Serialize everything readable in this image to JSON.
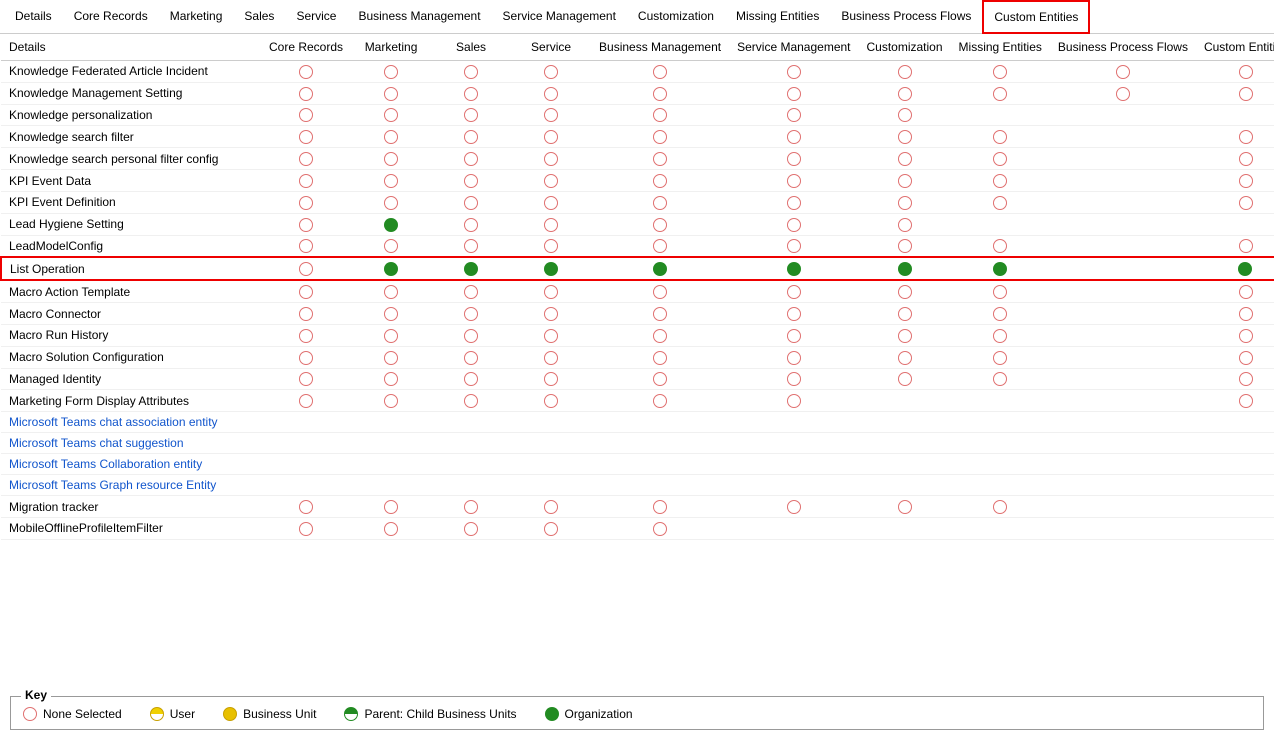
{
  "tabs": [
    {
      "id": "details",
      "label": "Details",
      "active": false,
      "highlighted": false
    },
    {
      "id": "core-records",
      "label": "Core Records",
      "active": false,
      "highlighted": false
    },
    {
      "id": "marketing",
      "label": "Marketing",
      "active": false,
      "highlighted": false
    },
    {
      "id": "sales",
      "label": "Sales",
      "active": false,
      "highlighted": false
    },
    {
      "id": "service",
      "label": "Service",
      "active": false,
      "highlighted": false
    },
    {
      "id": "business-management",
      "label": "Business Management",
      "active": false,
      "highlighted": false
    },
    {
      "id": "service-management",
      "label": "Service Management",
      "active": false,
      "highlighted": false
    },
    {
      "id": "customization",
      "label": "Customization",
      "active": false,
      "highlighted": false
    },
    {
      "id": "missing-entities",
      "label": "Missing Entities",
      "active": false,
      "highlighted": false
    },
    {
      "id": "business-process-flows",
      "label": "Business Process Flows",
      "active": false,
      "highlighted": false
    },
    {
      "id": "custom-entities",
      "label": "Custom Entities",
      "active": false,
      "highlighted": true
    }
  ],
  "columns": [
    "Details",
    "Core Records",
    "Marketing",
    "Sales",
    "Service",
    "Business Management",
    "Service Management",
    "Customization",
    "Missing Entities",
    "Business Process Flows",
    "Custom Entities"
  ],
  "rows": [
    {
      "name": "Knowledge Federated Article Incident",
      "link": false,
      "highlighted": false,
      "circles": [
        "empty",
        "empty",
        "empty",
        "empty",
        "empty",
        "empty",
        "empty",
        "empty",
        "empty",
        "empty",
        "empty"
      ]
    },
    {
      "name": "Knowledge Management Setting",
      "link": false,
      "highlighted": false,
      "circles": [
        "empty",
        "empty",
        "empty",
        "empty",
        "empty",
        "empty",
        "empty",
        "empty",
        "empty",
        "empty",
        "empty"
      ]
    },
    {
      "name": "Knowledge personalization",
      "link": false,
      "highlighted": false,
      "circles": [
        "empty",
        "empty",
        "empty",
        "empty",
        "empty",
        "empty",
        "empty",
        "empty",
        "none",
        "none",
        "none"
      ]
    },
    {
      "name": "Knowledge search filter",
      "link": false,
      "highlighted": false,
      "circles": [
        "empty",
        "empty",
        "empty",
        "empty",
        "empty",
        "empty",
        "empty",
        "empty",
        "empty",
        "none",
        "empty"
      ]
    },
    {
      "name": "Knowledge search personal filter config",
      "link": false,
      "highlighted": false,
      "circles": [
        "empty",
        "empty",
        "empty",
        "empty",
        "empty",
        "empty",
        "empty",
        "empty",
        "empty",
        "none",
        "empty"
      ]
    },
    {
      "name": "KPI Event Data",
      "link": false,
      "highlighted": false,
      "circles": [
        "empty",
        "empty",
        "empty",
        "empty",
        "empty",
        "empty",
        "empty",
        "empty",
        "empty",
        "none",
        "empty"
      ]
    },
    {
      "name": "KPI Event Definition",
      "link": false,
      "highlighted": false,
      "circles": [
        "empty",
        "empty",
        "empty",
        "empty",
        "empty",
        "empty",
        "empty",
        "empty",
        "empty",
        "none",
        "empty"
      ]
    },
    {
      "name": "Lead Hygiene Setting",
      "link": false,
      "highlighted": false,
      "circles": [
        "empty",
        "empty",
        "green",
        "empty",
        "empty",
        "empty",
        "empty",
        "empty",
        "none",
        "none",
        "none"
      ]
    },
    {
      "name": "LeadModelConfig",
      "link": false,
      "highlighted": false,
      "circles": [
        "empty",
        "empty",
        "empty",
        "empty",
        "empty",
        "empty",
        "empty",
        "empty",
        "empty",
        "none",
        "empty"
      ]
    },
    {
      "name": "List Operation",
      "link": false,
      "highlighted": true,
      "circles": [
        "empty",
        "empty",
        "green",
        "green",
        "green",
        "green",
        "green",
        "green",
        "green",
        "none",
        "green"
      ]
    },
    {
      "name": "Macro Action Template",
      "link": false,
      "highlighted": false,
      "circles": [
        "empty",
        "empty",
        "empty",
        "empty",
        "empty",
        "empty",
        "empty",
        "empty",
        "empty",
        "none",
        "empty"
      ]
    },
    {
      "name": "Macro Connector",
      "link": false,
      "highlighted": false,
      "circles": [
        "empty",
        "empty",
        "empty",
        "empty",
        "empty",
        "empty",
        "empty",
        "empty",
        "empty",
        "none",
        "empty"
      ]
    },
    {
      "name": "Macro Run History",
      "link": false,
      "highlighted": false,
      "circles": [
        "empty",
        "empty",
        "empty",
        "empty",
        "empty",
        "empty",
        "empty",
        "empty",
        "empty",
        "none",
        "empty"
      ]
    },
    {
      "name": "Macro Solution Configuration",
      "link": false,
      "highlighted": false,
      "circles": [
        "empty",
        "empty",
        "empty",
        "empty",
        "empty",
        "empty",
        "empty",
        "empty",
        "empty",
        "none",
        "empty"
      ]
    },
    {
      "name": "Managed Identity",
      "link": false,
      "highlighted": false,
      "circles": [
        "empty",
        "empty",
        "empty",
        "empty",
        "empty",
        "empty",
        "empty",
        "empty",
        "empty",
        "none",
        "empty"
      ]
    },
    {
      "name": "Marketing Form Display Attributes",
      "link": false,
      "highlighted": false,
      "circles": [
        "empty",
        "empty",
        "empty",
        "empty",
        "empty",
        "empty",
        "empty",
        "none",
        "none",
        "none",
        "empty"
      ]
    },
    {
      "name": "Microsoft Teams chat association entity",
      "link": true,
      "highlighted": false,
      "circles": [
        "none",
        "none",
        "none",
        "none",
        "none",
        "none",
        "none",
        "none",
        "none",
        "none",
        "none"
      ]
    },
    {
      "name": "Microsoft Teams chat suggestion",
      "link": true,
      "highlighted": false,
      "circles": [
        "none",
        "none",
        "none",
        "none",
        "none",
        "none",
        "none",
        "none",
        "none",
        "none",
        "none"
      ]
    },
    {
      "name": "Microsoft Teams Collaboration entity",
      "link": true,
      "highlighted": false,
      "circles": [
        "none",
        "none",
        "none",
        "none",
        "none",
        "none",
        "none",
        "none",
        "none",
        "none",
        "none"
      ]
    },
    {
      "name": "Microsoft Teams Graph resource Entity",
      "link": true,
      "highlighted": false,
      "circles": [
        "none",
        "none",
        "none",
        "none",
        "none",
        "none",
        "none",
        "none",
        "none",
        "none",
        "none"
      ]
    },
    {
      "name": "Migration tracker",
      "link": false,
      "highlighted": false,
      "circles": [
        "empty",
        "empty",
        "empty",
        "empty",
        "empty",
        "empty",
        "empty",
        "empty",
        "empty",
        "none",
        "none"
      ]
    },
    {
      "name": "MobileOfflineProfileItemFilter",
      "link": false,
      "highlighted": false,
      "circles": [
        "empty",
        "empty",
        "empty",
        "empty",
        "empty",
        "empty",
        "none",
        "none",
        "none",
        "none",
        "none"
      ]
    }
  ],
  "key": {
    "title": "Key",
    "items": [
      {
        "type": "empty",
        "label": "None Selected"
      },
      {
        "type": "half-yellow",
        "label": "User"
      },
      {
        "type": "yellow",
        "label": "Business Unit"
      },
      {
        "type": "green-half",
        "label": "Parent: Child Business Units"
      },
      {
        "type": "green",
        "label": "Organization"
      }
    ]
  }
}
